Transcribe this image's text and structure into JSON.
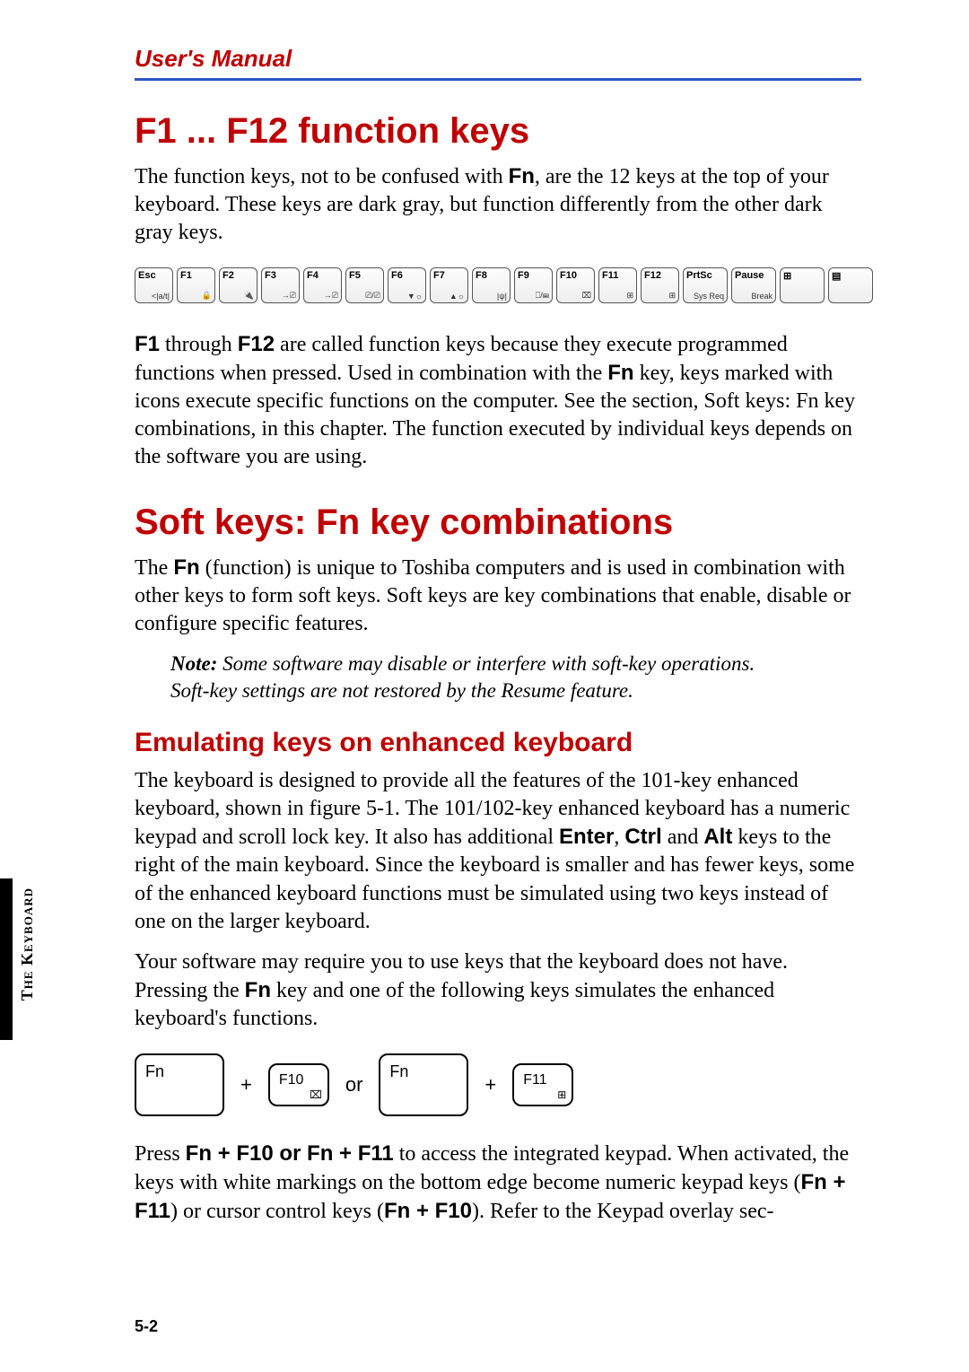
{
  "header": {
    "title": "User's Manual"
  },
  "h1": "F1 ... F12 function keys",
  "p1a": "The function keys, not to be confused with ",
  "p1fn": "Fn",
  "p1b": ", are the 12 keys at the top of your keyboard. These keys are dark gray, but function differently from the other dark gray keys.",
  "keys": [
    {
      "top": "Esc",
      "sub": "<|a/t|"
    },
    {
      "top": "F1",
      "sub": "🔒"
    },
    {
      "top": "F2",
      "sub": "🔌"
    },
    {
      "top": "F3",
      "sub": "→⎚"
    },
    {
      "top": "F4",
      "sub": "→⎚"
    },
    {
      "top": "F5",
      "sub": "⎚/⎚"
    },
    {
      "top": "F6",
      "sub": "▼☼"
    },
    {
      "top": "F7",
      "sub": "▲☼"
    },
    {
      "top": "F8",
      "sub": "|ψ|"
    },
    {
      "top": "F9",
      "sub": "⎕/⌨"
    },
    {
      "top": "F10",
      "sub": "⌧"
    },
    {
      "top": "F11",
      "sub": "⊞"
    },
    {
      "top": "F12",
      "sub": "⊞"
    },
    {
      "top": "PrtSc",
      "sub": "Sys Req"
    },
    {
      "top": "Pause",
      "sub": "Break"
    },
    {
      "top": "⊞",
      "sub": ""
    },
    {
      "top": "▤",
      "sub": ""
    }
  ],
  "p2a": "F1",
  "p2b": " through ",
  "p2c": "F12",
  "p2d": " are called function keys because they execute programmed functions when pressed. Used in combination with the ",
  "p2e": "Fn",
  "p2f": " key, keys marked with icons execute specific functions on the computer. See the section, Soft keys: Fn key combinations, in this chapter. The function executed by individual keys depends on the software you are using.",
  "h1b": "Soft keys: Fn key combinations",
  "p3a": "The ",
  "p3b": "Fn",
  "p3c": " (function) is unique to Toshiba computers and is used in combination with other keys to form soft keys. Soft keys are key combinations that enable, disable or configure specific features.",
  "note_label": "Note:",
  "note_body": " Some software may disable or interfere with soft-key operations. Soft-key settings are not restored by the Resume feature.",
  "h2": "Emulating keys on enhanced keyboard",
  "p4a": "The keyboard is designed to provide all the features of the 101-key enhanced keyboard, shown in figure 5-1. The 101/102-key enhanced keyboard has a numeric keypad and scroll lock key. It also has additional ",
  "p4enter": "Enter",
  "p4comma": ", ",
  "p4ctrl": "Ctrl",
  "p4and": " and ",
  "p4alt": "Alt",
  "p4b": " keys to the right of the main keyboard. Since the keyboard is smaller and has fewer keys, some of the enhanced keyboard functions must be simulated using two keys instead of one on the larger keyboard.",
  "p5a": "Your software may require you to use keys that the keyboard does not have. Pressing the ",
  "p5b": "Fn",
  "p5c": " key and one of the following keys simulates the enhanced keyboard's functions.",
  "combo": {
    "fn": "Fn",
    "plus": "+",
    "f10": "F10",
    "or": "or",
    "f11": "F11"
  },
  "p6a": "Press ",
  "p6b": "Fn + F10 or Fn + F11",
  "p6c": " to access the integrated keypad. When activated, the keys with white markings on the bottom edge become numeric keypad keys (",
  "p6d": "Fn + F11",
  "p6e": ") or cursor control keys (",
  "p6f": "Fn + F10",
  "p6g": "). Refer to the Keypad overlay sec-",
  "sidetab": "The Keyboard",
  "pagenum": "5-2"
}
